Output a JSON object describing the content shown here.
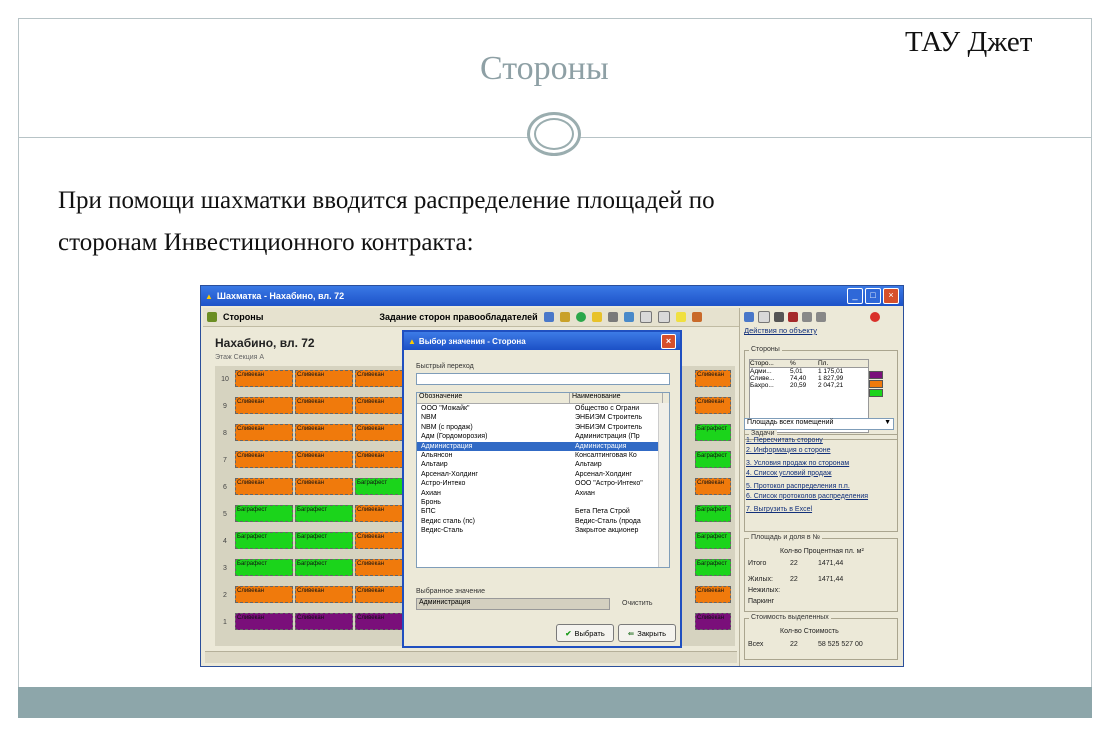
{
  "slide": {
    "title": "Стороны",
    "company": "ТАУ Джет",
    "body_line1": "При помощи шахматки вводится распределение площадей по",
    "body_line2": "сторонам Инвестиционного контракта:"
  },
  "window": {
    "title": "Шахматка - Нахабино, вл. 72",
    "toolbar_section": "Стороны",
    "toolbar_action": "Задание сторон правообладателей",
    "chess_title": "Нахабино, вл. 72",
    "chess_header": "Этаж  Секция А",
    "cell_label_orange": "Сливекан",
    "cell_label_green": "Баграфест",
    "floors": [
      "10",
      "9",
      "8",
      "7",
      "6",
      "5",
      "4",
      "3",
      "2",
      "1"
    ]
  },
  "right_pane": {
    "action_link": "Действия по объекту",
    "sides_group": "Стороны",
    "sides_cols": [
      "Сторо...",
      "%",
      "Пл."
    ],
    "sides_rows": [
      {
        "name": "Адми...",
        "pct": "5,01",
        "area": "1 175,01",
        "color": "#7a0f7a"
      },
      {
        "name": "Сливе...",
        "pct": "74,40",
        "area": "1 827,99",
        "color": "#f07a0c"
      },
      {
        "name": "Бахро...",
        "pct": "20,59",
        "area": "2 047,21",
        "color": "#1bd41b"
      }
    ],
    "area_select": "Площадь всех помещений",
    "tasks_group": "Задачи",
    "tasks": [
      "1. Пересчитать сторону",
      "2. Информация о стороне",
      "3. Условия продаж по сторонам",
      "4. Список условий продаж",
      "5. Протокол распределения п.п.",
      "6. Список протоколов распределения",
      "7. Выгрузить в Excel"
    ],
    "areas_group": "Площадь и доля в №",
    "areas_header": "Кол-во  Процентная пл. м²",
    "total_label": "Итого",
    "total_count": "22",
    "total_area": "1471,44",
    "living_label": "Жилых:",
    "living_count": "22",
    "living_area": "1471,44",
    "nonliving_label": "Нежилых:",
    "parking_label": "Паркинг",
    "cost_group": "Стоимость выделенных",
    "cost_header": "Кол-во  Стоимость",
    "cost_total_label": "Всех",
    "cost_total_count": "22",
    "cost_total_value": "58 525 527 00"
  },
  "dialog": {
    "title": "Выбор значения - Сторона",
    "filter_label": "Быстрый переход",
    "col_name": "Обозначение",
    "col_title": "Наименование",
    "rows": [
      {
        "code": "ООО \"Можайк\"",
        "name": "Общество с Ограни"
      },
      {
        "code": "NBM",
        "name": "ЭНБИЭМ Строитель"
      },
      {
        "code": "NBM (с продаж)",
        "name": "ЭНБИЭМ Строитель"
      },
      {
        "code": "Адм (Гордоморозия)",
        "name": "Администрация (Пр"
      },
      {
        "code": "Администрация",
        "name": "Администрация"
      },
      {
        "code": "Альянсон",
        "name": "Консалтинговая Ко"
      },
      {
        "code": "Альтаир",
        "name": "Альтаир"
      },
      {
        "code": "Арсенал-Холдинг",
        "name": "Арсенал-Холдинг"
      },
      {
        "code": "Астро-Интеко",
        "name": "ООО \"Астро-Интеко\""
      },
      {
        "code": "Ахиан",
        "name": "Ахиан"
      },
      {
        "code": "Бронь",
        "name": ""
      },
      {
        "code": "БПС",
        "name": "Бета Пета Строй"
      },
      {
        "code": "Ведис сталь (пс)",
        "name": "Ведис-Сталь (прода"
      },
      {
        "code": "Ведис-Сталь",
        "name": "Закрытое акционер"
      }
    ],
    "selected_label": "Выбранное значение",
    "selected_value": "Администрация",
    "clear_label": "Очистить",
    "choose_label": "Выбрать",
    "close_label": "Закрыть"
  },
  "colors": {
    "orange": "#f07a0c",
    "green": "#1bd41b",
    "purple": "#7a0f7a",
    "accent": "#316ac5"
  }
}
